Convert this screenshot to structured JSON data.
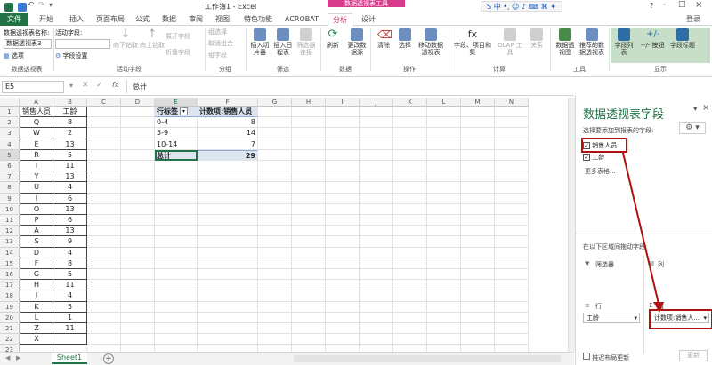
{
  "window": {
    "title": "工作簿1 - Excel",
    "context_tools": "数据透视表工具",
    "login": "登录",
    "help": "?"
  },
  "tabs": [
    "文件",
    "开始",
    "插入",
    "页面布局",
    "公式",
    "数据",
    "审阅",
    "视图",
    "特色功能",
    "ACROBAT",
    "分析",
    "设计"
  ],
  "ribbon": {
    "pivot_name_label": "数据透视表名称:",
    "pivot_name_value": "数据透视表3",
    "options_label": "选项",
    "active_field_label": "活动字段:",
    "field_settings": "字段设置",
    "drill_down": "向下钻取",
    "drill_up": "向上钻取",
    "expand_field": "展开字段",
    "collapse_field": "折叠字段",
    "group_selection": "组选择",
    "ungroup": "取消组合",
    "group_field": "组字段",
    "insert_slicer": "插入切片器",
    "insert_timeline": "插入日程表",
    "filter_connections": "筛选器连接",
    "refresh": "刷新",
    "change_source": "更改数据源",
    "clear": "清除",
    "select": "选择",
    "move_pivot": "移动数据透视表",
    "fields_items_sets": "字段、项目和集",
    "olap_tools": "OLAP 工具",
    "relationships": "关系",
    "pivot_chart": "数据透视图",
    "recommended_pivot": "推荐的数据透视表",
    "field_list": "字段列表",
    "buttons": "+/- 按钮",
    "field_headers": "字段标题",
    "groups": {
      "pivot": "数据透视表",
      "active_field": "活动字段",
      "group": "分组",
      "filter": "筛选",
      "data": "数据",
      "actions": "操作",
      "calculations": "计算",
      "tools": "工具",
      "show": "显示"
    }
  },
  "formula_bar": {
    "name_box": "E5",
    "fx": "fx",
    "content": "总计"
  },
  "grid": {
    "columns": [
      "A",
      "B",
      "C",
      "D",
      "E",
      "F",
      "G",
      "H",
      "I",
      "J",
      "K",
      "L",
      "M",
      "N"
    ],
    "rows": [
      "1",
      "2",
      "3",
      "4",
      "5",
      "6",
      "7",
      "8",
      "9",
      "10",
      "11",
      "12",
      "13",
      "14",
      "15",
      "16",
      "17",
      "18",
      "19",
      "20",
      "21",
      "22",
      "23"
    ],
    "col_a": [
      "销售人员",
      "Q",
      "W",
      "E",
      "R",
      "T",
      "Y",
      "U",
      "I",
      "O",
      "P",
      "A",
      "S",
      "D",
      "F",
      "G",
      "H",
      "J",
      "K",
      "L",
      "Z",
      "X"
    ],
    "col_b": [
      "工龄",
      "8",
      "2",
      "13",
      "5",
      "11",
      "13",
      "4",
      "6",
      "13",
      "6",
      "13",
      "9",
      "4",
      "8",
      "5",
      "11",
      "4",
      "5",
      "1",
      "11",
      ""
    ],
    "pivot": {
      "header_label": "行标签",
      "header_value": "计数项:销售人员",
      "rows": [
        {
          "label": "0-4",
          "value": "8"
        },
        {
          "label": "5-9",
          "value": "14"
        },
        {
          "label": "10-14",
          "value": "7"
        }
      ],
      "total_label": "总计",
      "total_value": "29"
    }
  },
  "sheet": {
    "tab": "Sheet1",
    "add": "+"
  },
  "panel": {
    "title": "数据透视表字段",
    "subtitle": "选择要添加到报表的字段:",
    "fields": [
      {
        "label": "销售人员",
        "checked": true
      },
      {
        "label": "工龄",
        "checked": true
      }
    ],
    "more_tables": "更多表格...",
    "drag_hint": "在以下区域间拖动字段:",
    "filters_label": "筛选器",
    "columns_label": "列",
    "rows_label": "行",
    "values_label": "值",
    "rows_item": "工龄",
    "values_item": "计数项:销售人...",
    "defer_update": "推迟布局更新",
    "update_button": "更新",
    "close": "×",
    "settings": "⚙"
  },
  "colors": {
    "excel_green": "#217346",
    "context_pink": "#d83b8c",
    "annotation_red": "#b01010",
    "pivot_header_blue": "#dce6f1"
  }
}
